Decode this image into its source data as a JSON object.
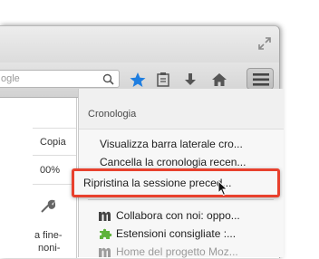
{
  "toolbar": {
    "url_placeholder": "ogle"
  },
  "sidebar": {
    "copy_label": "Copia",
    "zoom_label": "00%",
    "text_line1": "a fine-",
    "text_line2": "noni-"
  },
  "history_panel": {
    "title": "Cronologia",
    "items": [
      {
        "label": "Visualizza barra laterale cro..."
      },
      {
        "label": "Cancella la cronologia recen..."
      },
      {
        "label": "Ripristina la sessione preced..."
      }
    ],
    "recent": [
      {
        "label": "Collabora con noi: oppo...",
        "icon": "mozilla-m-icon"
      },
      {
        "label": "Estensioni consigliate :...",
        "icon": "puzzle-piece-icon"
      },
      {
        "label": "Home del progetto Moz...",
        "icon": "mozilla-m-icon"
      }
    ]
  },
  "colors": {
    "highlight_border": "#e8412e",
    "bookmark_star": "#1f7ee0",
    "extension_green": "#5fb33a"
  }
}
